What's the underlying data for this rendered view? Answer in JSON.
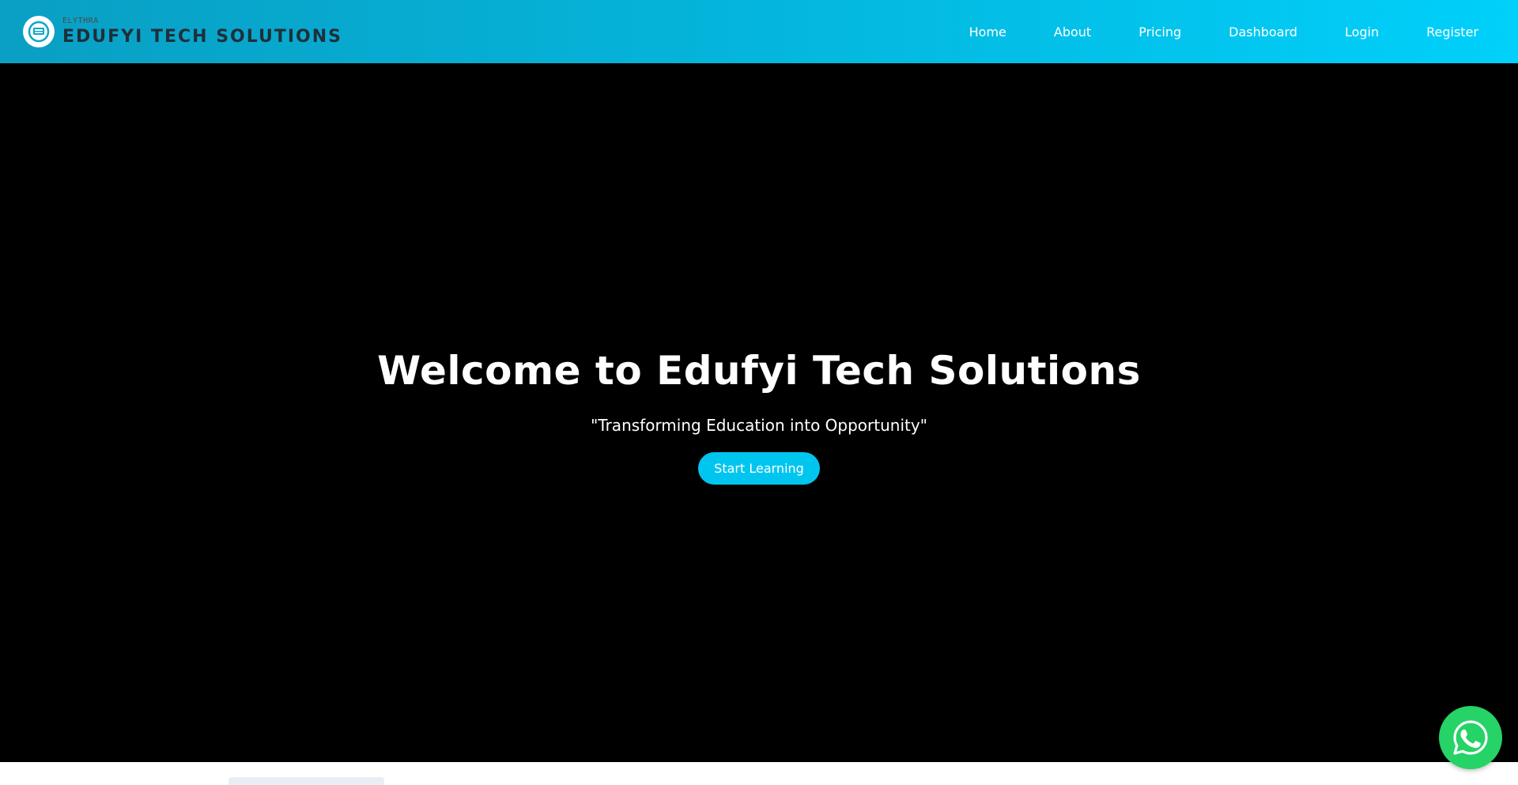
{
  "navbar": {
    "brand": {
      "tagline": "ELYTHRA",
      "name": "EDUFYI TECH SOLUTIONS",
      "logo_icon": "book-globe-icon"
    },
    "links": [
      {
        "label": "Home"
      },
      {
        "label": "About"
      },
      {
        "label": "Pricing"
      },
      {
        "label": "Dashboard"
      },
      {
        "label": "Login"
      },
      {
        "label": "Register"
      }
    ]
  },
  "hero": {
    "title": "Welcome to Edufyi Tech Solutions",
    "subtitle": "\"Transforming Education into Opportunity\"",
    "cta_label": "Start Learning"
  },
  "floating": {
    "whatsapp_icon": "whatsapp-icon"
  },
  "colors": {
    "accent": "#00c6ef",
    "navbar_start": "#0a9fc4",
    "navbar_end": "#00d0fb",
    "hero_bg": "#000000",
    "whatsapp": "#25d366"
  }
}
